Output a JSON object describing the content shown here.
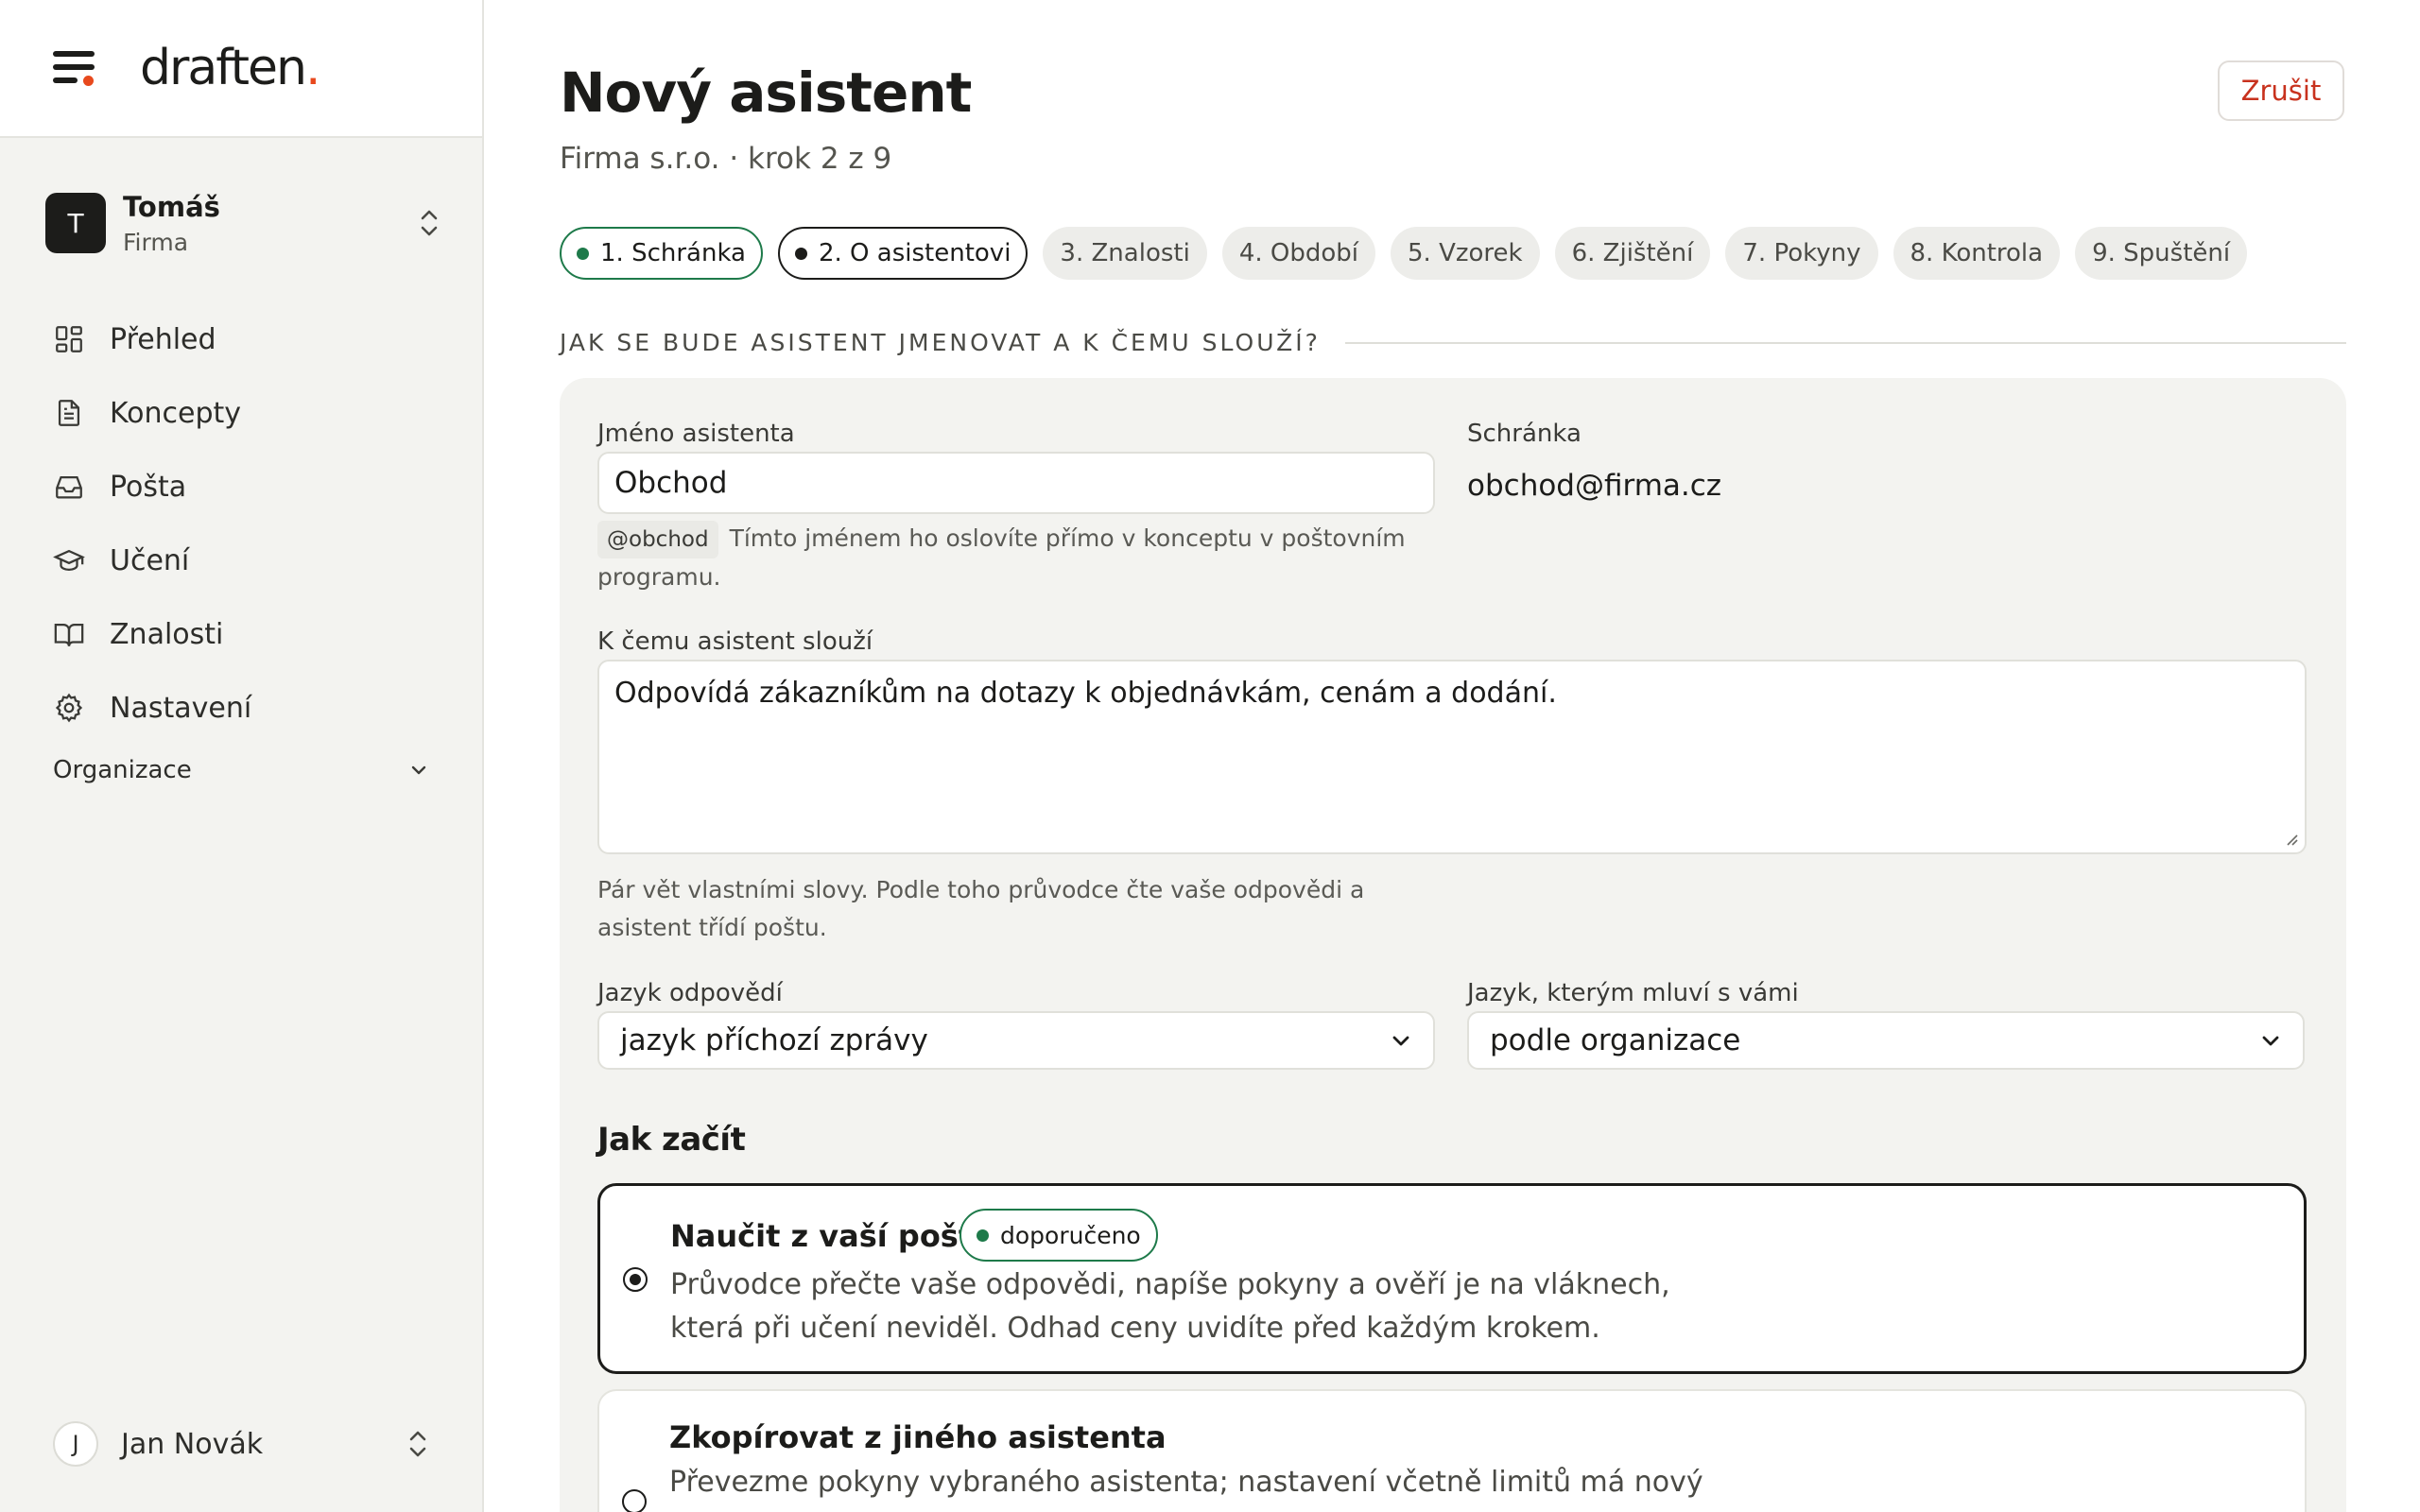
{
  "brand": {
    "name": "draften",
    "dot": ".",
    "accent_color": "#e8491d"
  },
  "account": {
    "initial": "T",
    "name": "Tomáš",
    "org": "Firma"
  },
  "nav": [
    {
      "label": "Přehled",
      "icon": "dashboard-icon"
    },
    {
      "label": "Koncepty",
      "icon": "document-icon"
    },
    {
      "label": "Pošta",
      "icon": "inbox-icon"
    },
    {
      "label": "Učení",
      "icon": "graduation-cap-icon"
    },
    {
      "label": "Znalosti",
      "icon": "book-icon"
    },
    {
      "label": "Nastavení",
      "icon": "gear-icon"
    }
  ],
  "organization": {
    "label": "Organizace"
  },
  "user": {
    "initial": "J",
    "name": "Jan Novák"
  },
  "header": {
    "title": "Nový asistent",
    "subtitle": "Firma s.r.o. · krok 2 z 9",
    "cancel_label": "Zrušit"
  },
  "steps": [
    {
      "label": "1. Schránka",
      "state": "done"
    },
    {
      "label": "2. O asistentovi",
      "state": "active"
    },
    {
      "label": "3. Znalosti",
      "state": "pending"
    },
    {
      "label": "4. Období",
      "state": "pending"
    },
    {
      "label": "5. Vzorek",
      "state": "pending"
    },
    {
      "label": "6. Zjištění",
      "state": "pending"
    },
    {
      "label": "7. Pokyny",
      "state": "pending"
    },
    {
      "label": "8. Kontrola",
      "state": "pending"
    },
    {
      "label": "9. Spuštění",
      "state": "pending"
    }
  ],
  "section": {
    "heading": "JAK SE BUDE ASISTENT JMENOVAT A K ČEMU SLOUŽÍ?"
  },
  "form": {
    "name_label": "Jméno asistenta",
    "name_value": "Obchod",
    "handle": "@obchod",
    "name_help_line1": "Tímto jménem ho oslovíte přímo v konceptu v poštovním",
    "name_help_line2": "programu.",
    "mailbox_label": "Schránka",
    "mailbox_value": "obchod@firma.cz",
    "purpose_label": "K čemu asistent slouží",
    "purpose_value": "Odpovídá zákazníkům na dotazy k objednávkám, cenám a dodání.",
    "purpose_help_line1": "Pár vět vlastními slovy. Podle toho průvodce čte vaše odpovědi a",
    "purpose_help_line2": "asistent třídí poštu.",
    "reply_lang_label": "Jazyk odpovědí",
    "reply_lang_value": "jazyk příchozí zprávy",
    "talk_lang_label": "Jazyk, kterým mluví s vámi",
    "talk_lang_value": "podle organizace"
  },
  "start": {
    "heading": "Jak začít",
    "options": [
      {
        "title": "Naučit z vaší pošty",
        "badge": "doporučeno",
        "desc_line1": "Průvodce přečte vaše odpovědi, napíše pokyny a ověří je na vláknech,",
        "desc_line2": "která při učení neviděl. Odhad ceny uvidíte před každým krokem.",
        "selected": true
      },
      {
        "title": "Zkopírovat z jiného asistenta",
        "desc_line1": "Převezme pokyny vybraného asistenta; nastavení včetně limitů má nový",
        "selected": false
      }
    ]
  },
  "colors": {
    "success": "#1e7a4a",
    "danger": "#c8321e",
    "sidebar_bg": "#f3f3f0"
  }
}
